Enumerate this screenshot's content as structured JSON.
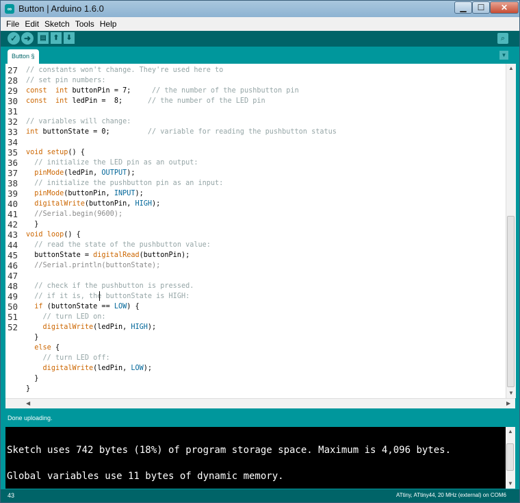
{
  "window": {
    "title": "Button | Arduino 1.6.0",
    "app_icon": "∞",
    "min": "▁",
    "max": "☐",
    "close": "✕"
  },
  "menu": [
    "File",
    "Edit",
    "Sketch",
    "Tools",
    "Help"
  ],
  "toolbar": {
    "verify": "✓",
    "upload": "➜",
    "new": "▤",
    "open": "⬆",
    "save": "⬇",
    "serial": "⌕"
  },
  "tab": {
    "label": "Button §",
    "menu": "▼"
  },
  "editor": {
    "line_numbers": [
      "27",
      "28",
      "29",
      "30",
      "31",
      "32",
      "33",
      "34",
      "35",
      "36",
      "37",
      "38",
      "39",
      "40",
      "41",
      "42",
      "43",
      "44",
      "45",
      "46",
      "47",
      "48",
      "49",
      "50",
      "51",
      "52"
    ],
    "code": [
      [
        [
          "cmt",
          "// constants won't change. They're used here to"
        ]
      ],
      [
        [
          "cmt",
          "// set pin numbers:"
        ]
      ],
      [
        [
          "kw",
          "const"
        ],
        [
          "",
          "  "
        ],
        [
          "kw",
          "int"
        ],
        [
          "",
          " buttonPin = 7;     "
        ],
        [
          "cmt",
          "// the number of the pushbutton pin"
        ]
      ],
      [
        [
          "kw",
          "const"
        ],
        [
          "",
          "  "
        ],
        [
          "kw",
          "int"
        ],
        [
          "",
          " ledPin =  8;      "
        ],
        [
          "cmt",
          "// the number of the LED pin"
        ]
      ],
      [
        [
          "",
          ""
        ]
      ],
      [
        [
          "cmt",
          "// variables will change:"
        ]
      ],
      [
        [
          "kw",
          "int"
        ],
        [
          "",
          " buttonState = 0;         "
        ],
        [
          "cmt",
          "// variable for reading the pushbutton status"
        ]
      ],
      [
        [
          "",
          ""
        ]
      ],
      [
        [
          "kw",
          "void"
        ],
        [
          "",
          " "
        ],
        [
          "fn",
          "setup"
        ],
        [
          "",
          "() {"
        ]
      ],
      [
        [
          "",
          "  "
        ],
        [
          "cmt",
          "// initialize the LED pin as an output:"
        ]
      ],
      [
        [
          "",
          "  "
        ],
        [
          "fn",
          "pinMode"
        ],
        [
          "",
          "(ledPin, "
        ],
        [
          "cst",
          "OUTPUT"
        ],
        [
          "",
          ");"
        ]
      ],
      [
        [
          "",
          "  "
        ],
        [
          "cmt",
          "// initialize the pushbutton pin as an input:"
        ]
      ],
      [
        [
          "",
          "  "
        ],
        [
          "fn",
          "pinMode"
        ],
        [
          "",
          "(buttonPin, "
        ],
        [
          "cst",
          "INPUT"
        ],
        [
          "",
          ");"
        ]
      ],
      [
        [
          "",
          "  "
        ],
        [
          "fn",
          "digitalWrite"
        ],
        [
          "",
          "(buttonPin, "
        ],
        [
          "cst",
          "HIGH"
        ],
        [
          "",
          ");"
        ]
      ],
      [
        [
          "",
          "  "
        ],
        [
          "dim",
          "//Serial.begin(9600);"
        ]
      ],
      [
        [
          "",
          "  }"
        ]
      ],
      [
        [
          "kw",
          "void"
        ],
        [
          "",
          " "
        ],
        [
          "fn",
          "loop"
        ],
        [
          "",
          "() {"
        ]
      ],
      [
        [
          "",
          "  "
        ],
        [
          "cmt",
          "// read the state of the pushbutton value:"
        ]
      ],
      [
        [
          "",
          "  buttonState = "
        ],
        [
          "fn",
          "digitalRead"
        ],
        [
          "",
          "(buttonPin);"
        ]
      ],
      [
        [
          "",
          "  "
        ],
        [
          "dim",
          "//Serial.println(buttonState);"
        ]
      ],
      [
        [
          "",
          ""
        ]
      ],
      [
        [
          "",
          "  "
        ],
        [
          "cmt",
          "// check if the pushbutton is pressed."
        ]
      ],
      [
        [
          "",
          "  "
        ],
        [
          "cmt",
          "// if it is, the buttonState is HIGH:"
        ]
      ],
      [
        [
          "",
          "  "
        ],
        [
          "kw",
          "if"
        ],
        [
          "",
          " (buttonState == "
        ],
        [
          "cst",
          "LOW"
        ],
        [
          "",
          ") {"
        ]
      ],
      [
        [
          "",
          "    "
        ],
        [
          "cmt",
          "// turn LED on:"
        ]
      ],
      [
        [
          "",
          "    "
        ],
        [
          "fn",
          "digitalWrite"
        ],
        [
          "",
          "(ledPin, "
        ],
        [
          "cst",
          "HIGH"
        ],
        [
          "",
          ");"
        ]
      ],
      [
        [
          "",
          "  }"
        ]
      ],
      [
        [
          "",
          "  "
        ],
        [
          "kw",
          "else"
        ],
        [
          "",
          " {"
        ]
      ],
      [
        [
          "",
          "    "
        ],
        [
          "cmt",
          "// turn LED off:"
        ]
      ],
      [
        [
          "",
          "    "
        ],
        [
          "fn",
          "digitalWrite"
        ],
        [
          "",
          "(ledPin, "
        ],
        [
          "cst",
          "LOW"
        ],
        [
          "",
          ");"
        ]
      ],
      [
        [
          "",
          "  }"
        ]
      ],
      [
        [
          "",
          "}"
        ]
      ]
    ]
  },
  "status": "Done uploading.",
  "console": [
    "Sketch uses 742 bytes (18%) of program storage space. Maximum is 4,096 bytes.",
    "Global variables use 11 bytes of dynamic memory."
  ],
  "footer": {
    "line": "43",
    "board": "ATtiny, ATtiny44, 20 MHz (external) on COM6"
  },
  "colors": {
    "teal": "#00979c",
    "dark_teal": "#006468",
    "keyword": "#cc6600",
    "constant": "#006699",
    "comment": "#95a5a6"
  }
}
